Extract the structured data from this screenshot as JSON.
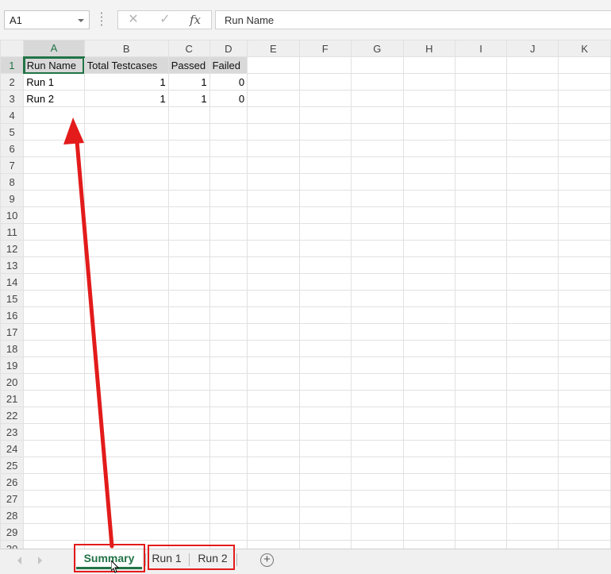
{
  "formula_bar": {
    "name_box": "A1",
    "cancel_icon": "✕",
    "enter_icon": "✓",
    "function_icon": "fx",
    "formula": "Run Name"
  },
  "columns": [
    "A",
    "B",
    "C",
    "D",
    "E",
    "F",
    "G",
    "H",
    "I",
    "J",
    "K"
  ],
  "rows": [
    "1",
    "2",
    "3",
    "4",
    "5",
    "6",
    "7",
    "8",
    "9",
    "10",
    "11",
    "12",
    "13",
    "14",
    "15",
    "16",
    "17",
    "18",
    "19",
    "20",
    "21",
    "22",
    "23",
    "24",
    "25",
    "26",
    "27",
    "28",
    "29",
    "30"
  ],
  "cells": {
    "header": {
      "a": "Run Name",
      "b": "Total Testcases",
      "c": "Passed",
      "d": "Failed"
    },
    "r2": {
      "a": "Run 1",
      "b": "1",
      "c": "1",
      "d": "0"
    },
    "r3": {
      "a": "Run 2",
      "b": "1",
      "c": "1",
      "d": "0"
    }
  },
  "sheet_tabs": [
    {
      "label": "Summary",
      "active": true
    },
    {
      "label": "Run 1",
      "active": false
    },
    {
      "label": "Run 2",
      "active": false
    }
  ],
  "add_sheet_icon": "+",
  "colors": {
    "accent": "#217346",
    "annotation": "#e31b1b",
    "header_fill": "#d9d9d9"
  }
}
